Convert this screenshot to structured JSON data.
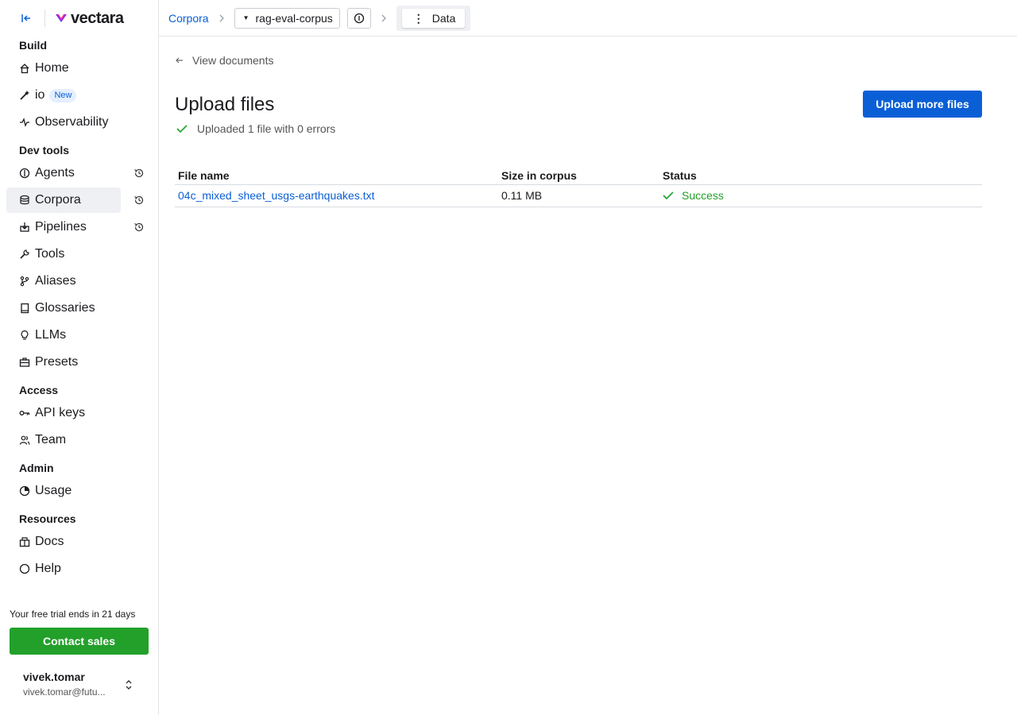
{
  "brand": {
    "name": "vectara"
  },
  "sidebar": {
    "sections": [
      {
        "title": "Build",
        "items": [
          {
            "label": "Home",
            "icon": "home-icon"
          },
          {
            "label": "io",
            "icon": "wand-icon",
            "badge": "New"
          },
          {
            "label": "Observability",
            "icon": "pulse-icon"
          }
        ]
      },
      {
        "title": "Dev tools",
        "items": [
          {
            "label": "Agents",
            "icon": "agent-icon"
          },
          {
            "label": "Corpora",
            "icon": "database-icon"
          },
          {
            "label": "Pipelines",
            "icon": "pipeline-icon"
          },
          {
            "label": "Tools",
            "icon": "wrench-icon"
          },
          {
            "label": "Aliases",
            "icon": "branch-icon"
          },
          {
            "label": "Glossaries",
            "icon": "book-icon"
          },
          {
            "label": "LLMs",
            "icon": "lightbulb-icon"
          },
          {
            "label": "Presets",
            "icon": "briefcase-icon"
          }
        ]
      },
      {
        "title": "Access",
        "items": [
          {
            "label": "API keys",
            "icon": "key-icon"
          },
          {
            "label": "Team",
            "icon": "team-icon"
          }
        ]
      },
      {
        "title": "Admin",
        "items": [
          {
            "label": "Usage",
            "icon": "pie-icon"
          }
        ]
      },
      {
        "title": "Resources",
        "items": [
          {
            "label": "Docs",
            "icon": "docs-icon"
          },
          {
            "label": "Help",
            "icon": "help-icon"
          }
        ]
      }
    ],
    "trial_text": "Your free trial ends in 21 days",
    "contact_label": "Contact sales",
    "user": {
      "name": "vivek.tomar",
      "email": "vivek.tomar@futu..."
    }
  },
  "breadcrumb": {
    "root": "Corpora",
    "corpus": "rag-eval-corpus",
    "current": "Data"
  },
  "main": {
    "back_label": "View documents",
    "title": "Upload files",
    "status_text": "Uploaded 1 file with 0 errors",
    "upload_more_label": "Upload more files",
    "table": {
      "headers": [
        "File name",
        "Size in corpus",
        "Status"
      ],
      "rows": [
        {
          "file": "04c_mixed_sheet_usgs-earthquakes.txt",
          "size": "0.11 MB",
          "status": "Success"
        }
      ]
    }
  },
  "colors": {
    "accent": "#0a5fd6",
    "success": "#22a02a",
    "active_bg": "#eef0f3"
  }
}
